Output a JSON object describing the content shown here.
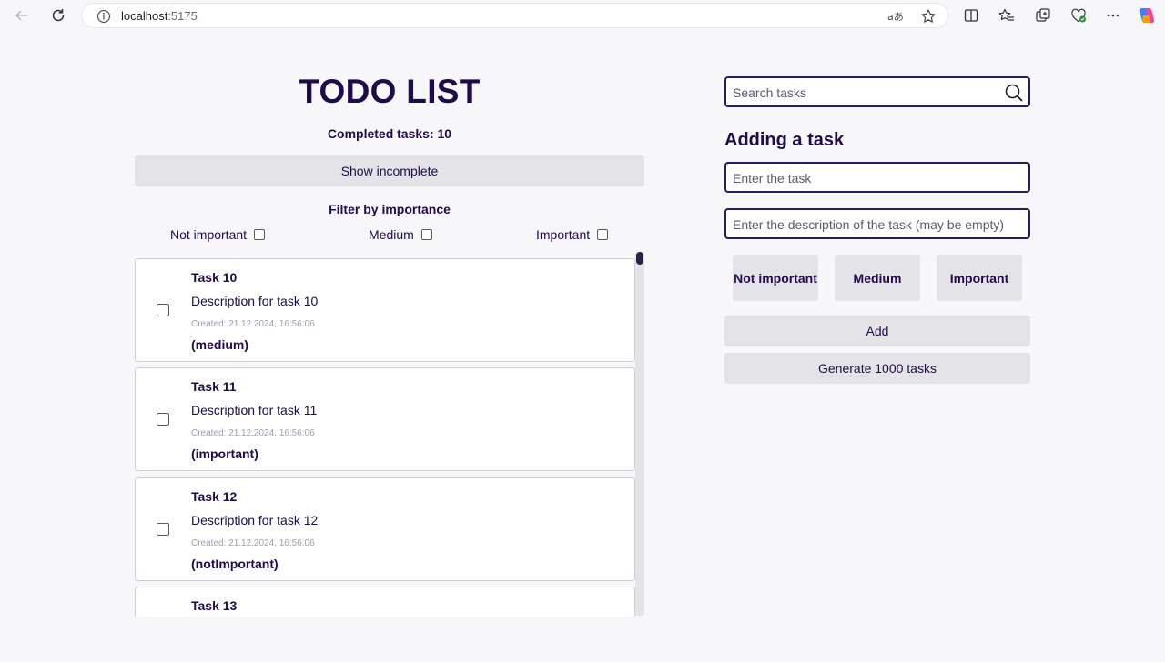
{
  "browser": {
    "url_host": "localhost",
    "url_port": ":5175"
  },
  "header": {
    "title": "TODO LIST",
    "completed_text": "Completed tasks: 10",
    "show_incomplete_label": "Show incomplete"
  },
  "filter": {
    "title": "Filter by importance",
    "options": [
      {
        "label": "Not important",
        "checked": false
      },
      {
        "label": "Medium",
        "checked": false
      },
      {
        "label": "Important",
        "checked": false
      }
    ]
  },
  "tasks": [
    {
      "name": "Task 10",
      "description": "Description for task 10",
      "created": "Created: 21.12.2024, 16:56:06",
      "priority": "(medium)",
      "done": false
    },
    {
      "name": "Task 11",
      "description": "Description for task 11",
      "created": "Created: 21.12.2024, 16:56:06",
      "priority": "(important)",
      "done": false
    },
    {
      "name": "Task 12",
      "description": "Description for task 12",
      "created": "Created: 21.12.2024, 16:56:06",
      "priority": "(notImportant)",
      "done": false
    },
    {
      "name": "Task 13",
      "description": "",
      "created": "",
      "priority": "",
      "done": false
    }
  ],
  "search": {
    "placeholder": "Search tasks"
  },
  "add_form": {
    "title": "Adding a task",
    "task_placeholder": "Enter the task",
    "description_placeholder": "Enter the description of the task (may be empty)",
    "priority_buttons": [
      "Not important",
      "Medium",
      "Important"
    ],
    "add_label": "Add",
    "generate_label": "Generate 1000 tasks"
  },
  "colors": {
    "text": "#1f0b4a",
    "button_bg": "#e4e3e8",
    "input_border": "#2a1a5e",
    "page_bg": "#f7f7f9"
  }
}
